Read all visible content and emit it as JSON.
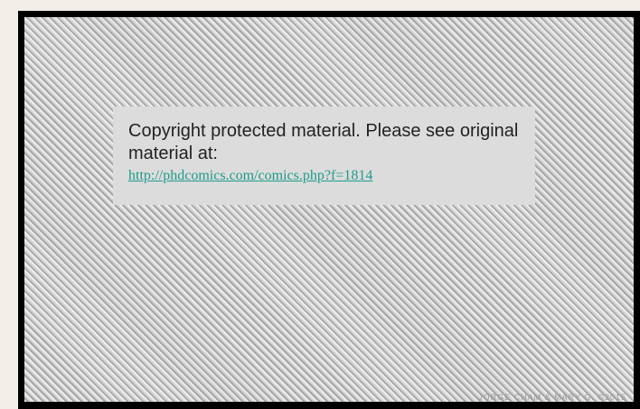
{
  "notice": {
    "message": "Copyright protected material. Please see original material at:",
    "link_text": "http://phdcomics.com/comics.php?f=1814"
  },
  "footer": {
    "credit": "JORGE CHAM & MARY G. ©2015"
  },
  "colors": {
    "page_background": "#f3efe8",
    "frame": "#000000",
    "notice_background": "#dcdcdc",
    "link": "#1f9b8b"
  }
}
